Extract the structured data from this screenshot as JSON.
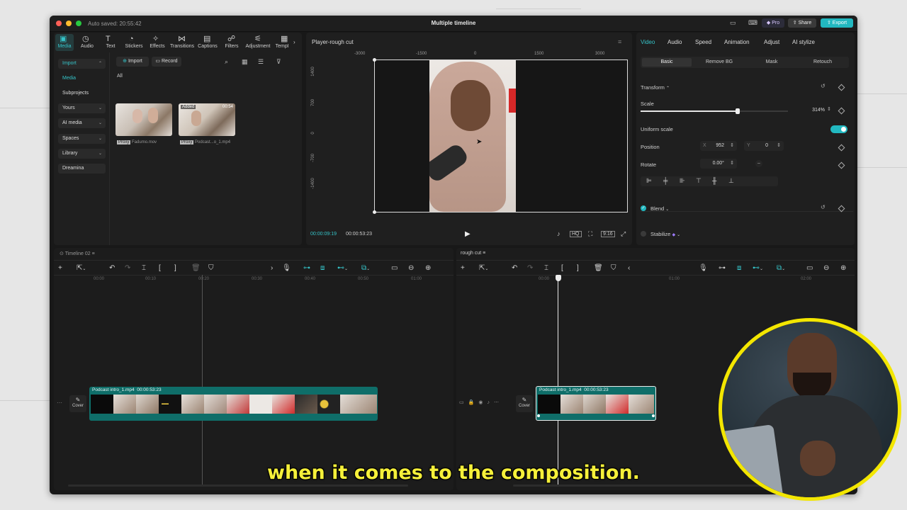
{
  "window": {
    "autosave": "Auto saved: 20:55:42",
    "title": "Multiple timeline",
    "pro_label": "Pro",
    "share_label": "Share",
    "export_label": "Export"
  },
  "toolbar": {
    "items": [
      "Media",
      "Audio",
      "Text",
      "Stickers",
      "Effects",
      "Transitions",
      "Captions",
      "Filters",
      "Adjustment",
      "Templ"
    ],
    "icons": [
      "media-icon",
      "audio-icon",
      "text-icon",
      "stickers-icon",
      "effects-icon",
      "transitions-icon",
      "captions-icon",
      "filters-icon",
      "adjustment-icon",
      "templates-icon"
    ]
  },
  "sidebar": {
    "items": [
      {
        "label": "Import",
        "chevron": "⌃"
      },
      {
        "label": "Media",
        "chevron": ""
      },
      {
        "label": "Subprojects",
        "chevron": ""
      },
      {
        "label": "Yours",
        "chevron": "⌄"
      },
      {
        "label": "AI media",
        "chevron": "⌄"
      },
      {
        "label": "Spaces",
        "chevron": "⌄"
      },
      {
        "label": "Library",
        "chevron": "⌄"
      },
      {
        "label": "Dreamina",
        "chevron": ""
      }
    ]
  },
  "media": {
    "import_label": "Import",
    "record_label": "Record",
    "filter_all": "All",
    "items": [
      {
        "badge": "Proxy",
        "name": "Fadumo.mov",
        "tag": "",
        "duration": ""
      },
      {
        "badge": "Proxy",
        "name": "Podcast...o_1.mp4",
        "tag": "Added",
        "duration": "00:54"
      }
    ]
  },
  "player": {
    "title": "Player-rough cut",
    "ruler_top": [
      "-3000",
      "-1500",
      "0",
      "1500",
      "3000"
    ],
    "ruler_left": [
      "1400",
      "700",
      "0",
      "-700",
      "-1400"
    ],
    "current_time": "00:00:09:19",
    "total_time": "00:00:53:23",
    "ratio_label": "9:16"
  },
  "properties": {
    "tabs": [
      "Video",
      "Audio",
      "Speed",
      "Animation",
      "Adjust",
      "AI stylize"
    ],
    "subtabs": [
      "Basic",
      "Remove BG",
      "Mask",
      "Retouch"
    ],
    "transform_label": "Transform",
    "scale_label": "Scale",
    "scale_value": "314%",
    "scale_fraction": 0.66,
    "uniform_scale_label": "Uniform scale",
    "position_label": "Position",
    "pos_x_label": "X",
    "pos_x": "952",
    "pos_y_label": "Y",
    "pos_y": "0",
    "rotate_label": "Rotate",
    "rotate_value": "0.00°",
    "blend_label": "Blend",
    "stabilize_label": "Stabilize"
  },
  "timeline_left": {
    "title": "Timeline 02",
    "ruler": [
      "00:00",
      "00:10",
      "00:20",
      "00:30",
      "00:40",
      "00:50",
      "01:00"
    ],
    "clip_name": "Podcast intro_1.mp4",
    "clip_duration": "00:00:53:23",
    "cover_label": "Cover"
  },
  "timeline_right": {
    "title": "rough cut",
    "ruler": [
      "00:00",
      "01:00",
      "02:00"
    ],
    "clip_name": "Podcast intro_1.mp4",
    "clip_duration": "00:00:53:23",
    "cover_label": "Cover"
  },
  "subtitle": "when it comes to the composition.",
  "colors": {
    "accent": "#35c3c8",
    "clip": "#0f6e69",
    "subtitle": "#f5f03a",
    "webcam_ring": "#f3e600"
  }
}
